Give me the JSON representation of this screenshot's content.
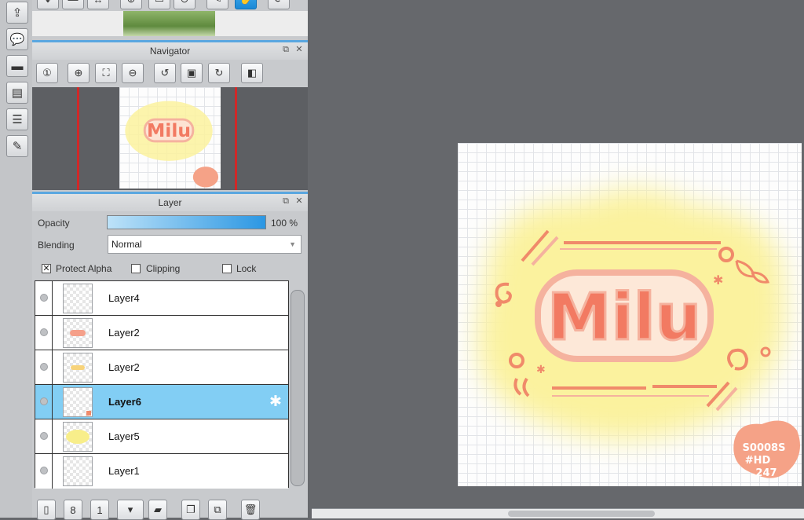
{
  "rail": {
    "items": [
      {
        "name": "export-icon",
        "glyph": "⇪"
      },
      {
        "name": "speech-bubble-icon",
        "glyph": "●"
      },
      {
        "name": "comment-icon",
        "glyph": "▬"
      },
      {
        "name": "document-icon",
        "glyph": "▤"
      },
      {
        "name": "list-icon",
        "glyph": "☰"
      },
      {
        "name": "edit-panel-icon",
        "glyph": "✎"
      }
    ]
  },
  "navigator": {
    "title": "Navigator",
    "tools": [
      {
        "name": "zoom-reset-icon",
        "glyph": "①"
      },
      {
        "name": "zoom-in-icon",
        "glyph": "⊕"
      },
      {
        "name": "fit-screen-icon",
        "glyph": "⛶"
      },
      {
        "name": "zoom-out-icon",
        "glyph": "⊖"
      },
      {
        "name": "rotate-left-icon",
        "glyph": "↺"
      },
      {
        "name": "actual-size-icon",
        "glyph": "▣"
      },
      {
        "name": "rotate-right-icon",
        "glyph": "↻"
      },
      {
        "name": "flip-icon",
        "glyph": "◧"
      }
    ]
  },
  "layer_panel": {
    "title": "Layer",
    "opacity_label": "Opacity",
    "opacity_value": "100 %",
    "opacity_fraction": 1.0,
    "blending_label": "Blending",
    "blending_value": "Normal",
    "protect_alpha_label": "Protect Alpha",
    "protect_alpha_checked": true,
    "clipping_label": "Clipping",
    "clipping_checked": false,
    "lock_label": "Lock",
    "lock_checked": false,
    "layers": [
      {
        "name": "Layer4",
        "selected": false
      },
      {
        "name": "Layer2",
        "selected": false
      },
      {
        "name": "Layer2",
        "selected": false
      },
      {
        "name": "Layer6",
        "selected": true
      },
      {
        "name": "Layer5",
        "selected": false
      },
      {
        "name": "Layer1",
        "selected": false
      }
    ],
    "bottom_tools": [
      {
        "name": "new-layer-icon",
        "glyph": "▯"
      },
      {
        "name": "new-8bit-layer-icon",
        "glyph": "8"
      },
      {
        "name": "new-1bit-layer-icon",
        "glyph": "1"
      },
      {
        "name": "add-menu-icon",
        "glyph": "▾"
      },
      {
        "name": "folder-icon",
        "glyph": "▰"
      },
      {
        "name": "duplicate-layer-icon",
        "glyph": "❐"
      },
      {
        "name": "merge-layer-icon",
        "glyph": "⧉"
      },
      {
        "name": "delete-layer-icon",
        "glyph": "🗑"
      }
    ]
  },
  "artwork": {
    "word": "Milu",
    "signature_lines": [
      "S0008S",
      "#HD",
      "247"
    ],
    "colors": {
      "glow": "#fbf29e",
      "letters": "#f27a62",
      "outline": "#f5b29e",
      "accent": "#f08a6a"
    }
  }
}
